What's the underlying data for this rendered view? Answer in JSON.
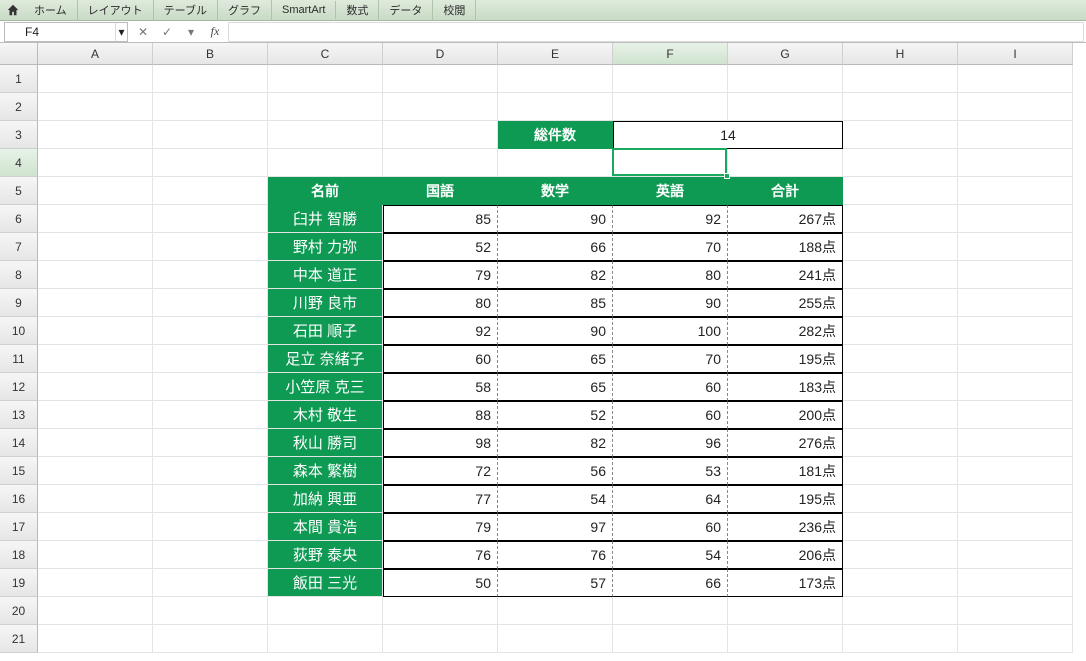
{
  "ribbon": {
    "tabs": [
      "ホーム",
      "レイアウト",
      "テーブル",
      "グラフ",
      "SmartArt",
      "数式",
      "データ",
      "校閲"
    ]
  },
  "formula_bar": {
    "name_box": "F4",
    "fx_label": "fx",
    "cancel_glyph": "✕",
    "confirm_glyph": "✓",
    "dropdown_glyph": "▾"
  },
  "columns": [
    "A",
    "B",
    "C",
    "D",
    "E",
    "F",
    "G",
    "H",
    "I"
  ],
  "rows_count": 21,
  "active_col": "F",
  "active_row": 4,
  "summary": {
    "label": "総件数",
    "value": "14"
  },
  "table": {
    "headers": [
      "名前",
      "国語",
      "数学",
      "英語",
      "合計"
    ],
    "suffix": "点",
    "rows": [
      {
        "name": "臼井 智勝",
        "k": 85,
        "m": 90,
        "e": 92,
        "t": 267
      },
      {
        "name": "野村 力弥",
        "k": 52,
        "m": 66,
        "e": 70,
        "t": 188
      },
      {
        "name": "中本 道正",
        "k": 79,
        "m": 82,
        "e": 80,
        "t": 241
      },
      {
        "name": "川野 良市",
        "k": 80,
        "m": 85,
        "e": 90,
        "t": 255
      },
      {
        "name": "石田 順子",
        "k": 92,
        "m": 90,
        "e": 100,
        "t": 282
      },
      {
        "name": "足立 奈緒子",
        "k": 60,
        "m": 65,
        "e": 70,
        "t": 195
      },
      {
        "name": "小笠原 克三",
        "k": 58,
        "m": 65,
        "e": 60,
        "t": 183
      },
      {
        "name": "木村 敬生",
        "k": 88,
        "m": 52,
        "e": 60,
        "t": 200
      },
      {
        "name": "秋山 勝司",
        "k": 98,
        "m": 82,
        "e": 96,
        "t": 276
      },
      {
        "name": "森本 繁樹",
        "k": 72,
        "m": 56,
        "e": 53,
        "t": 181
      },
      {
        "name": "加納 興亜",
        "k": 77,
        "m": 54,
        "e": 64,
        "t": 195
      },
      {
        "name": "本間 貴浩",
        "k": 79,
        "m": 97,
        "e": 60,
        "t": 236
      },
      {
        "name": "荻野 泰央",
        "k": 76,
        "m": 76,
        "e": 54,
        "t": 206
      },
      {
        "name": "飯田 三光",
        "k": 50,
        "m": 57,
        "e": 66,
        "t": 173
      }
    ]
  }
}
